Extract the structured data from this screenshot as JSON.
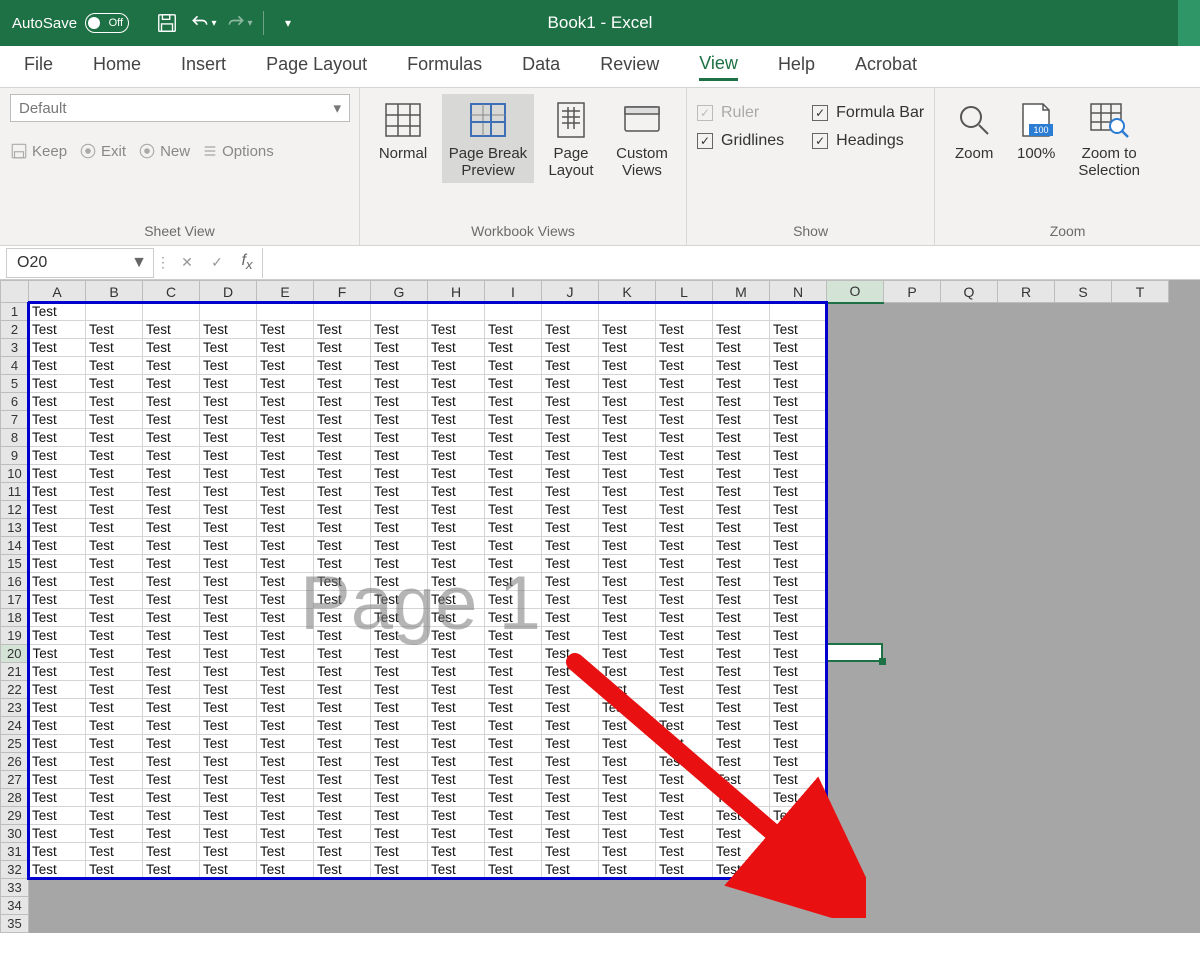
{
  "title": "Book1  -  Excel",
  "autosave": {
    "label": "AutoSave",
    "state": "Off"
  },
  "tabs": [
    "File",
    "Home",
    "Insert",
    "Page Layout",
    "Formulas",
    "Data",
    "Review",
    "View",
    "Help",
    "Acrobat"
  ],
  "active_tab": "View",
  "groups": {
    "sheet_view": {
      "select_value": "Default",
      "keep": "Keep",
      "exit": "Exit",
      "new": "New",
      "options": "Options",
      "label": "Sheet View"
    },
    "workbook_views": {
      "normal": "Normal",
      "page_break": "Page Break Preview",
      "page_layout": "Page Layout",
      "custom": "Custom Views",
      "label": "Workbook Views"
    },
    "show": {
      "ruler": {
        "label": "Ruler",
        "checked": true,
        "disabled": true
      },
      "formula_bar": {
        "label": "Formula Bar",
        "checked": true
      },
      "gridlines": {
        "label": "Gridlines",
        "checked": true
      },
      "headings": {
        "label": "Headings",
        "checked": true
      },
      "label": "Show"
    },
    "zoom": {
      "zoom": "Zoom",
      "hundred": "100%",
      "selection": "Zoom to Selection",
      "label": "Zoom"
    }
  },
  "name_box": "O20",
  "columns": [
    "A",
    "B",
    "C",
    "D",
    "E",
    "F",
    "G",
    "H",
    "I",
    "J",
    "K",
    "L",
    "M",
    "N",
    "O",
    "P",
    "Q",
    "R",
    "S",
    "T"
  ],
  "selected_col": "O",
  "selected_row": 20,
  "data_cols": 14,
  "total_rows": 35,
  "data_rows": 32,
  "cell_value": "Test",
  "watermark": "Page 1",
  "annotation_arrow": {
    "color": "#e81010"
  }
}
